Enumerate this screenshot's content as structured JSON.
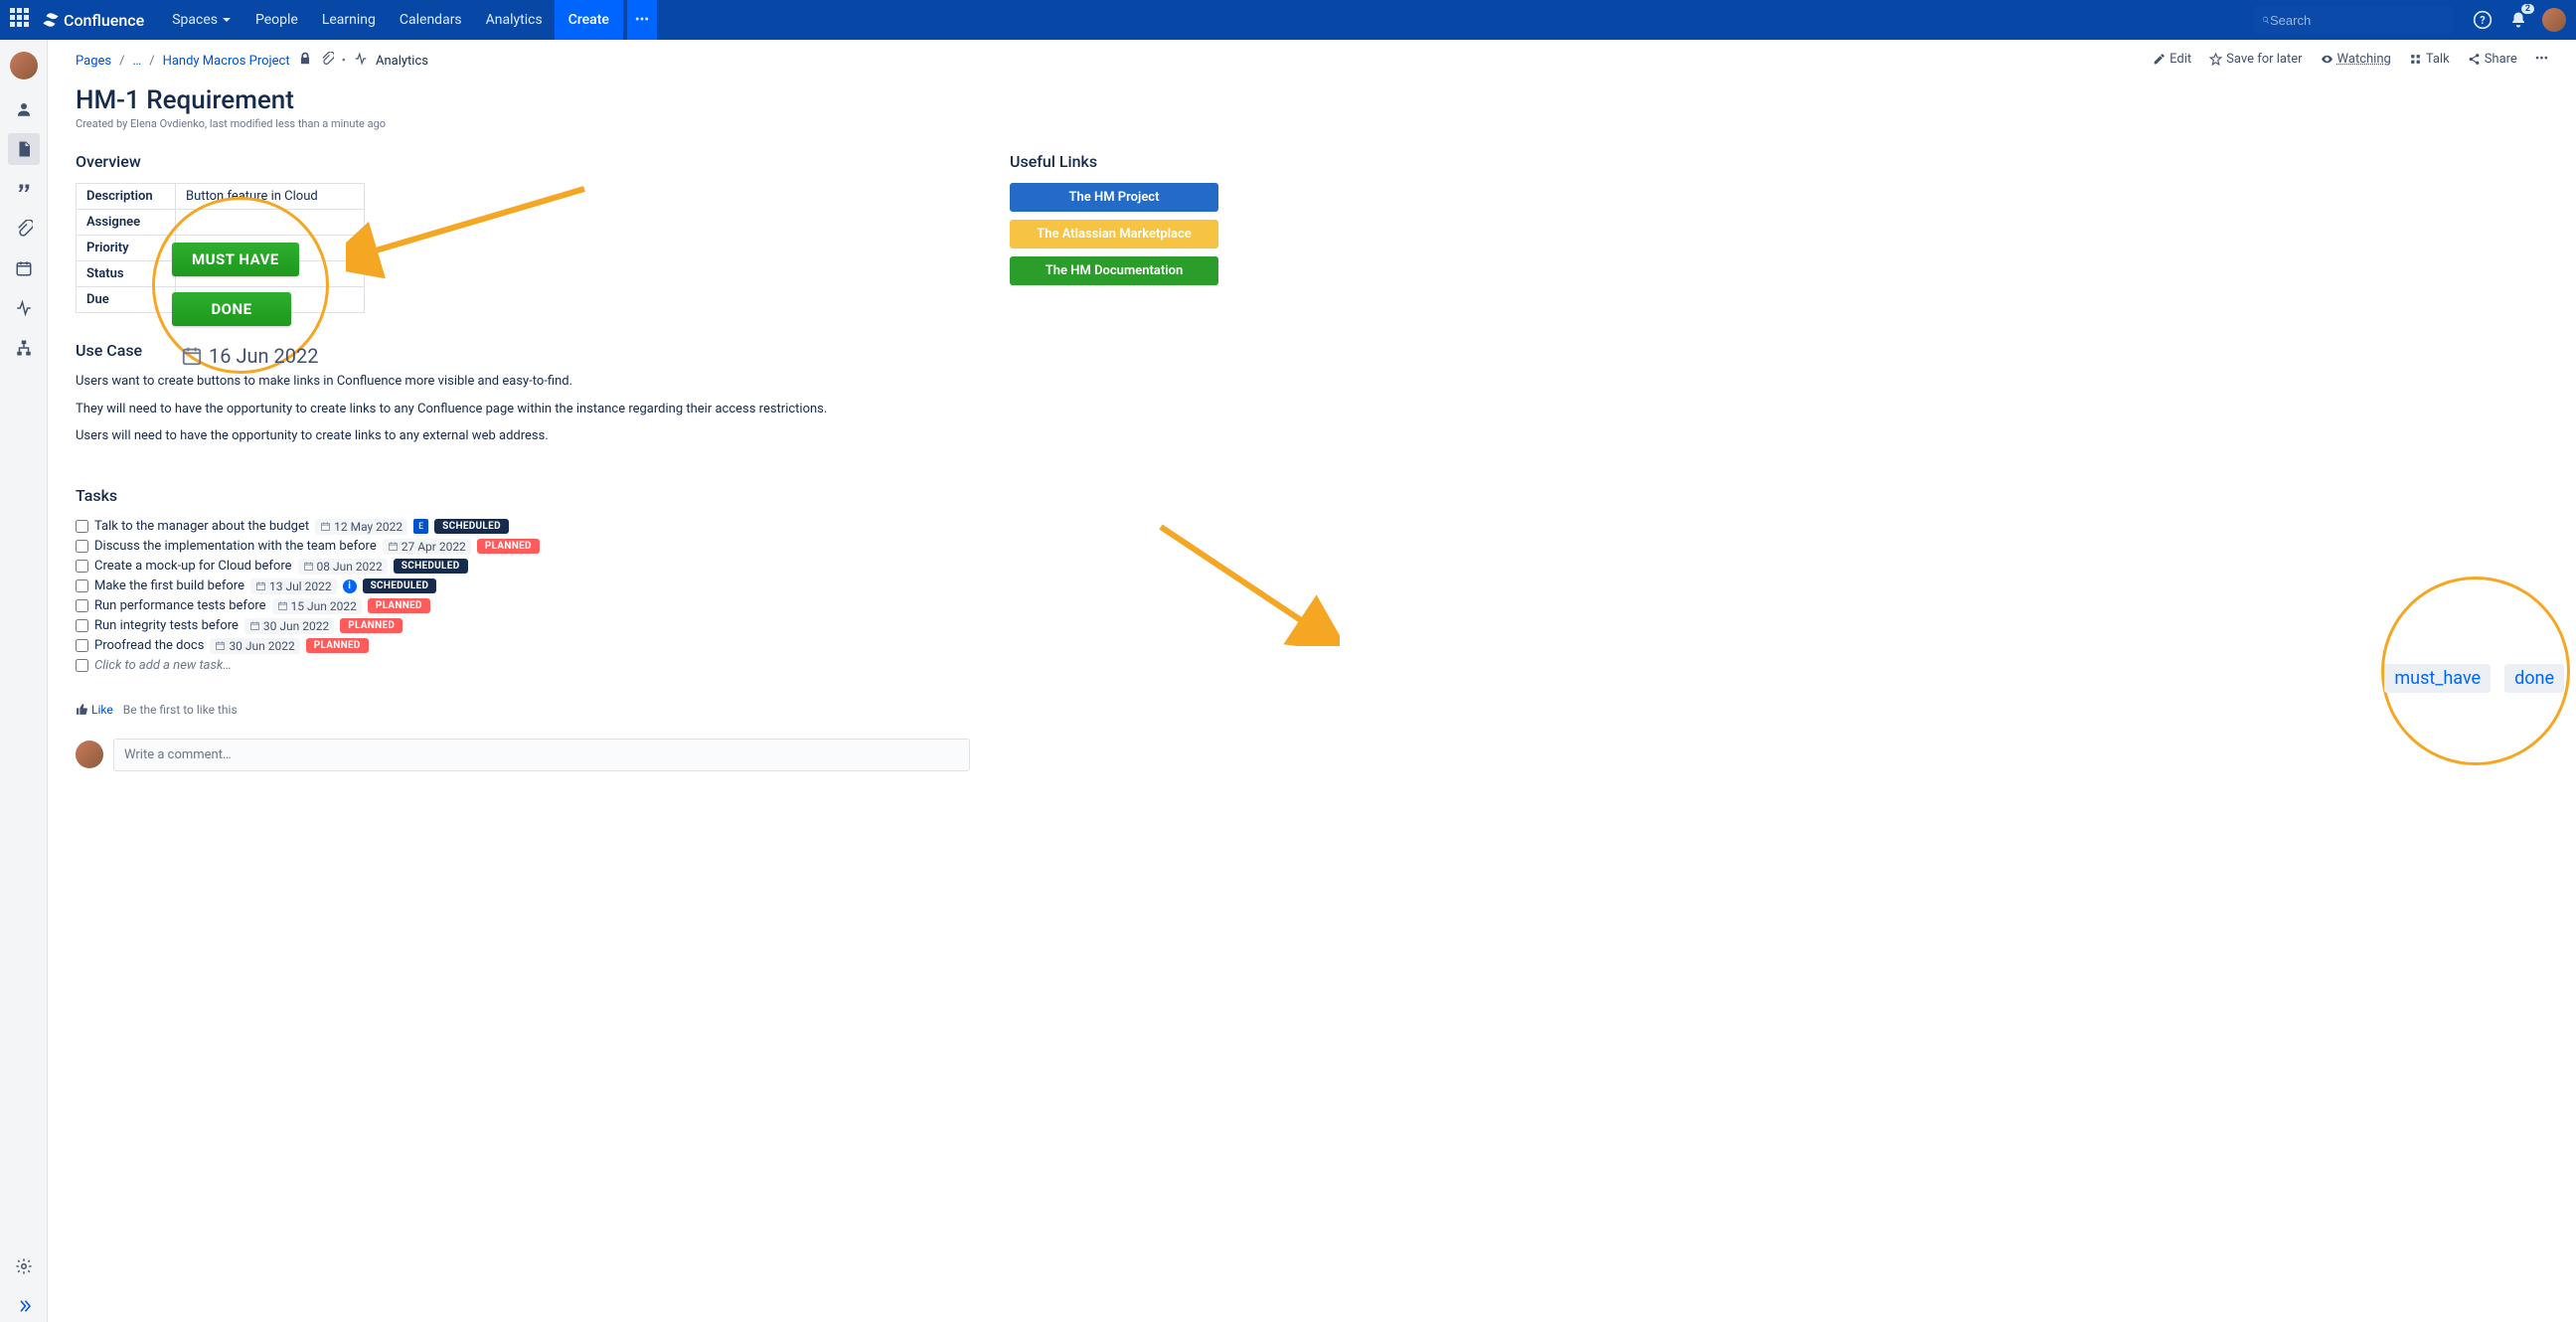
{
  "nav": {
    "product": "Confluence",
    "items": [
      "Spaces",
      "People",
      "Learning",
      "Calendars",
      "Analytics"
    ],
    "create": "Create",
    "search_placeholder": "Search"
  },
  "breadcrumbs": {
    "pages": "Pages",
    "dots": "…",
    "project": "Handy Macros Project",
    "analytics": "Analytics"
  },
  "actions": {
    "edit": "Edit",
    "save": "Save for later",
    "watching": "Watching",
    "talk": "Talk",
    "share": "Share"
  },
  "page": {
    "title": "HM-1 Requirement",
    "meta": "Created by Elena Ovdienko, last modified less than a minute ago",
    "overview_heading": "Overview",
    "useful_heading": "Useful Links",
    "usecase_heading": "Use Case",
    "tasks_heading": "Tasks"
  },
  "table": {
    "rows": [
      {
        "label": "Description",
        "value": "Button feature in Cloud"
      },
      {
        "label": "Assignee",
        "value": ""
      },
      {
        "label": "Priority",
        "value": ""
      },
      {
        "label": "Status",
        "value": ""
      },
      {
        "label": "Due",
        "value": ""
      }
    ]
  },
  "overlay": {
    "must_have": "MUST HAVE",
    "done": "DONE",
    "date": "16 Jun 2022"
  },
  "usecase": {
    "p1": "Users want to create buttons to make links in Confluence more visible and easy-to-find.",
    "p2": "They will need to have the opportunity to create links to any Confluence page within the instance regarding their access restrictions.",
    "p3": "Users will need to have the opportunity to create links to any external web address."
  },
  "tasks": [
    {
      "text": "Talk to the manager about the budget",
      "date": "12 May 2022",
      "status": "SCHEDULED",
      "user": true
    },
    {
      "text": "Discuss the implementation with the team before",
      "date": "27 Apr 2022",
      "status": "PLANNED"
    },
    {
      "text": "Create a mock-up for Cloud before",
      "date": "08 Jun 2022",
      "status": "SCHEDULED"
    },
    {
      "text": "Make the first build before",
      "date": "13 Jul 2022",
      "status": "SCHEDULED",
      "info": true
    },
    {
      "text": "Run performance tests before",
      "date": "15 Jun 2022",
      "status": "PLANNED"
    },
    {
      "text": "Run integrity tests before",
      "date": "30 Jun 2022",
      "status": "PLANNED"
    },
    {
      "text": "Proofread the docs",
      "date": "30 Jun 2022",
      "status": "PLANNED"
    }
  ],
  "task_add": "Click to add a new task…",
  "like": {
    "label": "Like",
    "first": "Be the first to like this"
  },
  "comment_placeholder": "Write a comment…",
  "links": [
    {
      "label": "The HM Project",
      "cls": "link-blue"
    },
    {
      "label": "The Atlassian Marketplace",
      "cls": "link-yellow"
    },
    {
      "label": "The HM Documentation",
      "cls": "link-green"
    }
  ],
  "tags": [
    "must_have",
    "done"
  ]
}
